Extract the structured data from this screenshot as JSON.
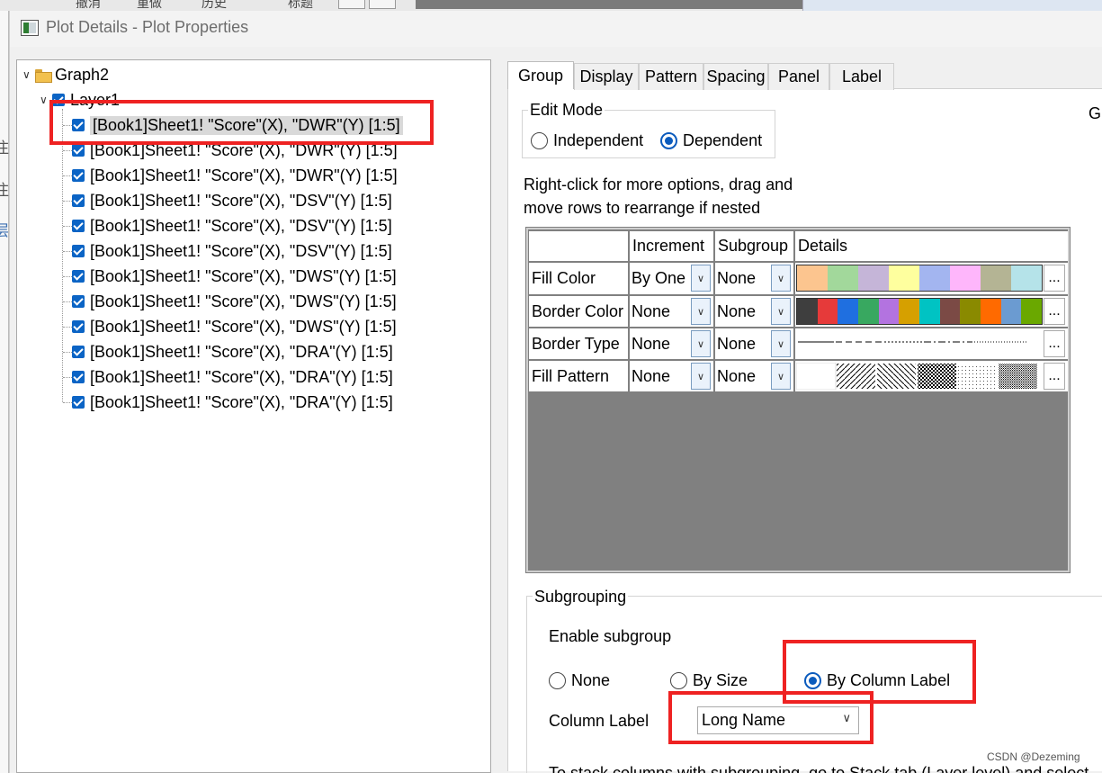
{
  "window": {
    "title": "Plot Details - Plot Properties"
  },
  "background": {
    "menu_fragments": [
      "撤消",
      "重做",
      "历史",
      "标题"
    ],
    "side_glyphs": [
      "注",
      "注",
      "层"
    ]
  },
  "tree": {
    "root": "Graph2",
    "layer": "Layer1",
    "plots": [
      "[Book1]Sheet1! \"Score\"(X), \"DWR\"(Y) [1:5]",
      "[Book1]Sheet1! \"Score\"(X), \"DWR\"(Y) [1:5]",
      "[Book1]Sheet1! \"Score\"(X), \"DWR\"(Y) [1:5]",
      "[Book1]Sheet1! \"Score\"(X), \"DSV\"(Y) [1:5]",
      "[Book1]Sheet1! \"Score\"(X), \"DSV\"(Y) [1:5]",
      "[Book1]Sheet1! \"Score\"(X), \"DSV\"(Y) [1:5]",
      "[Book1]Sheet1! \"Score\"(X), \"DWS\"(Y) [1:5]",
      "[Book1]Sheet1! \"Score\"(X), \"DWS\"(Y) [1:5]",
      "[Book1]Sheet1! \"Score\"(X), \"DWS\"(Y) [1:5]",
      "[Book1]Sheet1! \"Score\"(X), \"DRA\"(Y) [1:5]",
      "[Book1]Sheet1! \"Score\"(X), \"DRA\"(Y) [1:5]",
      "[Book1]Sheet1! \"Score\"(X), \"DRA\"(Y) [1:5]"
    ]
  },
  "tabs": [
    "Group",
    "Display",
    "Pattern",
    "Spacing",
    "Panel",
    "Label"
  ],
  "right_cut_label": "Gr",
  "edit_mode": {
    "label": "Edit Mode",
    "options": [
      "Independent",
      "Dependent"
    ],
    "selected": "Dependent"
  },
  "hint_lines": [
    "Right-click for more options, drag and",
    "move rows to  rearrange if nested"
  ],
  "grid": {
    "headers": [
      "",
      "Increment",
      "Subgroup",
      "Details"
    ],
    "rows": [
      {
        "name": "Fill Color",
        "increment": "By One",
        "subgroup": "None"
      },
      {
        "name": "Border Color",
        "increment": "None",
        "subgroup": "None"
      },
      {
        "name": "Border Type",
        "increment": "None",
        "subgroup": "None"
      },
      {
        "name": "Fill Pattern",
        "increment": "None",
        "subgroup": "None"
      }
    ],
    "ellipsis": "...",
    "fill_colors": [
      "#fcc58f",
      "#a2d89b",
      "#c5b5d8",
      "#feff9e",
      "#a3b5f0",
      "#feb6fb",
      "#b4b494",
      "#b5e3e9"
    ],
    "border_colors": [
      "#3e3e3e",
      "#e63a3a",
      "#1f6fe0",
      "#38a860",
      "#b373e0",
      "#d6a000",
      "#00c3c3",
      "#7b4a45",
      "#8a8a00",
      "#ff6a00",
      "#6b9bd1",
      "#6aa800"
    ]
  },
  "subgrouping": {
    "label": "Subgrouping",
    "enable_label": "Enable subgroup",
    "options": [
      "None",
      "By Size",
      "By Column Label"
    ],
    "selected": "By Column Label",
    "column_label_caption": "Column Label",
    "column_label_value": "Long Name",
    "bottom_text": "To stack columns with subgrouping, go to Stack tab (Layer level) and select"
  },
  "watermark": "CSDN @Dezeming"
}
